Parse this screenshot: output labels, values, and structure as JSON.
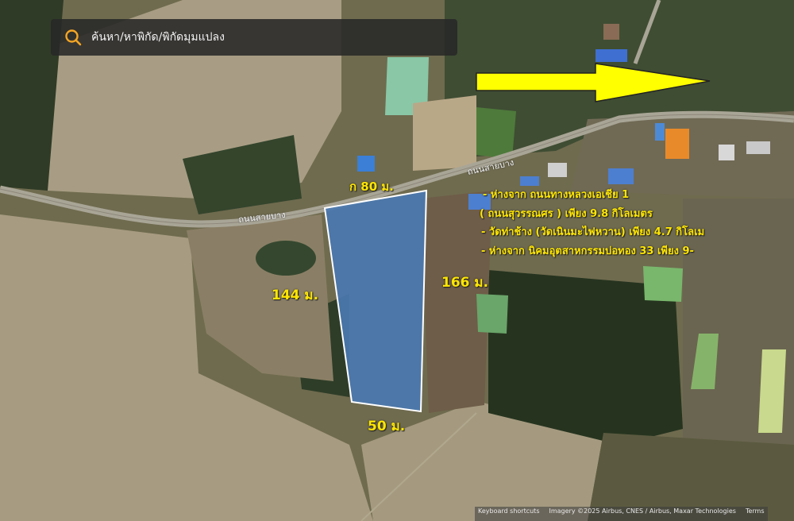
{
  "search": {
    "placeholder": "ค้นหา/หาพิกัด/พิกัดมุมแปลง",
    "icon": "search-icon"
  },
  "road_labels": [
    "ถนนสายบาง",
    "ถนนสายบาง"
  ],
  "plot_dimensions": {
    "top": "ก 80 ม.",
    "left": "144 ม.",
    "right": "166 ม.",
    "bottom": "50 ม."
  },
  "info_lines": [
    "-  ห่างจาก ถนนทางหลวงเอเชีย 1",
    "( ถนนสุวรรณศร )  เพียง 9.8 กิโลเมตร",
    "-  วัดท่าช้าง (วัดเนินมะไฟหวาน)  เพียง 4.7 กิโลเม",
    "-  ห่างจาก นิคมอุตสาหกรรมบ่อทอง 33  เพียง 9-"
  ],
  "attribution": [
    "Keyboard shortcuts",
    "Imagery ©2025 Airbus, CNES / Airbus, Maxar Technologies",
    "Terms"
  ],
  "colors": {
    "accent": "#ffe600",
    "plot_fill": "#4a78b0",
    "arrow": "#ffff00",
    "search_icon": "#f5a623"
  }
}
